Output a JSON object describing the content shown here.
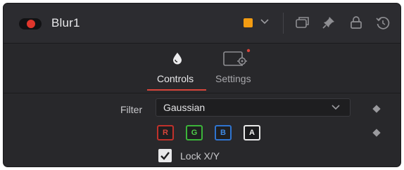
{
  "header": {
    "node_name": "Blur1",
    "color_swatch": "#f39c12",
    "toggle_color": "#e0362c",
    "icons": [
      "version-icon",
      "pin-icon",
      "lock-icon",
      "reset-icon"
    ]
  },
  "tabs": [
    {
      "label": "Controls",
      "icon": "droplet-icon",
      "active": true
    },
    {
      "label": "Settings",
      "icon": "settings-gear-icon",
      "active": false
    }
  ],
  "controls": {
    "filter_label": "Filter",
    "filter_value": "Gaussian",
    "channels": [
      {
        "label": "R",
        "color": "#c0312b"
      },
      {
        "label": "G",
        "color": "#3cb43a"
      },
      {
        "label": "B",
        "color": "#2f74d0"
      },
      {
        "label": "A",
        "color": "#e8e8e8"
      }
    ],
    "lock_label": "Lock X/Y",
    "lock_checked": true
  },
  "accent_color": "#d8453a"
}
